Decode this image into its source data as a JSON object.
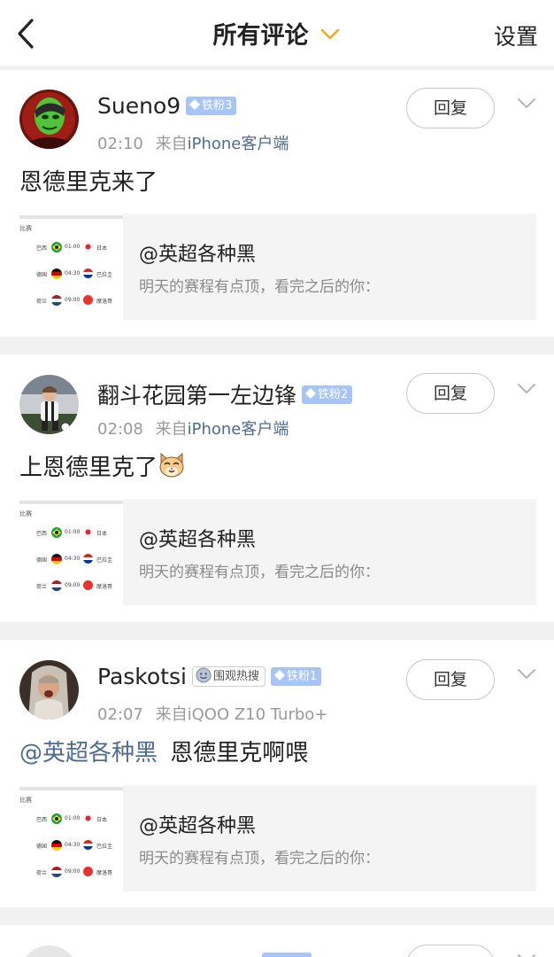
{
  "header": {
    "back_icon": "chevron-left-icon",
    "title": "所有评论",
    "title_dropdown_icon": "chevron-down-icon",
    "settings_label": "设置",
    "accent_color": "#f5a623"
  },
  "reply_label": "回复",
  "colors": {
    "fan_badge": "#a6c4f7",
    "link": "#4e6b93",
    "meta": "#999999",
    "page_gap": "#f1f1f1"
  },
  "comments": [
    {
      "username": "Sueno9",
      "fan_badge": "铁粉3",
      "time": "02:10",
      "source_prefix": "来自",
      "device": "iPhone客户端",
      "text": "恩德里克来了",
      "share": {
        "title": "@英超各种黑",
        "desc": "明天的赛程有点顶，看完之后的你：",
        "thumb": {
          "tag": "比赛",
          "rows": [
            {
              "home": "巴西",
              "time": "01:00",
              "away": "日本"
            },
            {
              "home": "德国",
              "time": "04:30",
              "away": "巴拉圭"
            },
            {
              "home": "荷兰",
              "time": "09:00",
              "away": "摩洛哥"
            }
          ]
        }
      }
    },
    {
      "username": "翻斗花园第一左边锋",
      "fan_badge": "铁粉2",
      "time": "02:08",
      "source_prefix": "来自",
      "device": "iPhone客户端",
      "text": "上恩德里克了",
      "emoji": "cat-face-emoji",
      "share": {
        "title": "@英超各种黑",
        "desc": "明天的赛程有点顶，看完之后的你：",
        "thumb": {
          "tag": "比赛",
          "rows": [
            {
              "home": "巴西",
              "time": "01:00",
              "away": "日本"
            },
            {
              "home": "德国",
              "time": "04:30",
              "away": "巴拉圭"
            },
            {
              "home": "荷兰",
              "time": "09:00",
              "away": "摩洛哥"
            }
          ]
        }
      }
    },
    {
      "username": "Paskotsi",
      "hot_badge": "围观热搜",
      "fan_badge": "铁粉1",
      "time": "02:07",
      "source_prefix": "来自",
      "device": "iQOO Z10 Turbo+",
      "mention": "@英超各种黑",
      "text": "恩德里克啊喂",
      "share": {
        "title": "@英超各种黑",
        "desc": "明天的赛程有点顶，看完之后的你：",
        "thumb": {
          "tag": "比赛",
          "rows": [
            {
              "home": "巴西",
              "time": "01:00",
              "away": "日本"
            },
            {
              "home": "德国",
              "time": "04:30",
              "away": "巴拉圭"
            },
            {
              "home": "荷兰",
              "time": "09:00",
              "away": "摩洛哥"
            }
          ]
        }
      }
    }
  ]
}
